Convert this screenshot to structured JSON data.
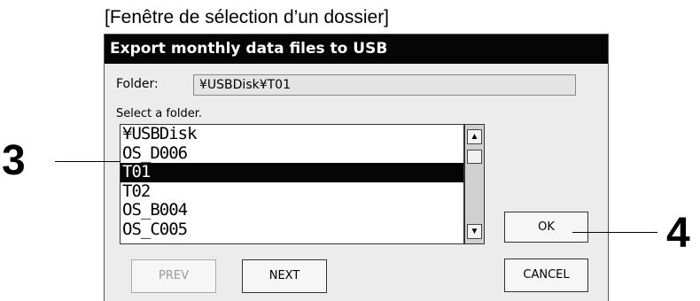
{
  "caption": "[Fenêtre de sélection d’un dossier]",
  "dialog": {
    "title": "Export monthly data files to USB",
    "folder_label": "Folder:",
    "folder_value": "¥USBDisk¥T01",
    "select_label": "Select a folder.",
    "folders": [
      "¥USBDisk",
      "OS_D006",
      "T01",
      "T02",
      "OS_B004",
      "OS_C005"
    ],
    "selected_index": 2,
    "prev_label": "PREV",
    "next_label": "NEXT",
    "ok_label": "OK",
    "cancel_label": "CANCEL"
  },
  "callouts": [
    "3",
    "4"
  ],
  "icons": {
    "scroll_up": "scroll-up-arrow-icon",
    "scroll_down": "scroll-down-arrow-icon"
  }
}
